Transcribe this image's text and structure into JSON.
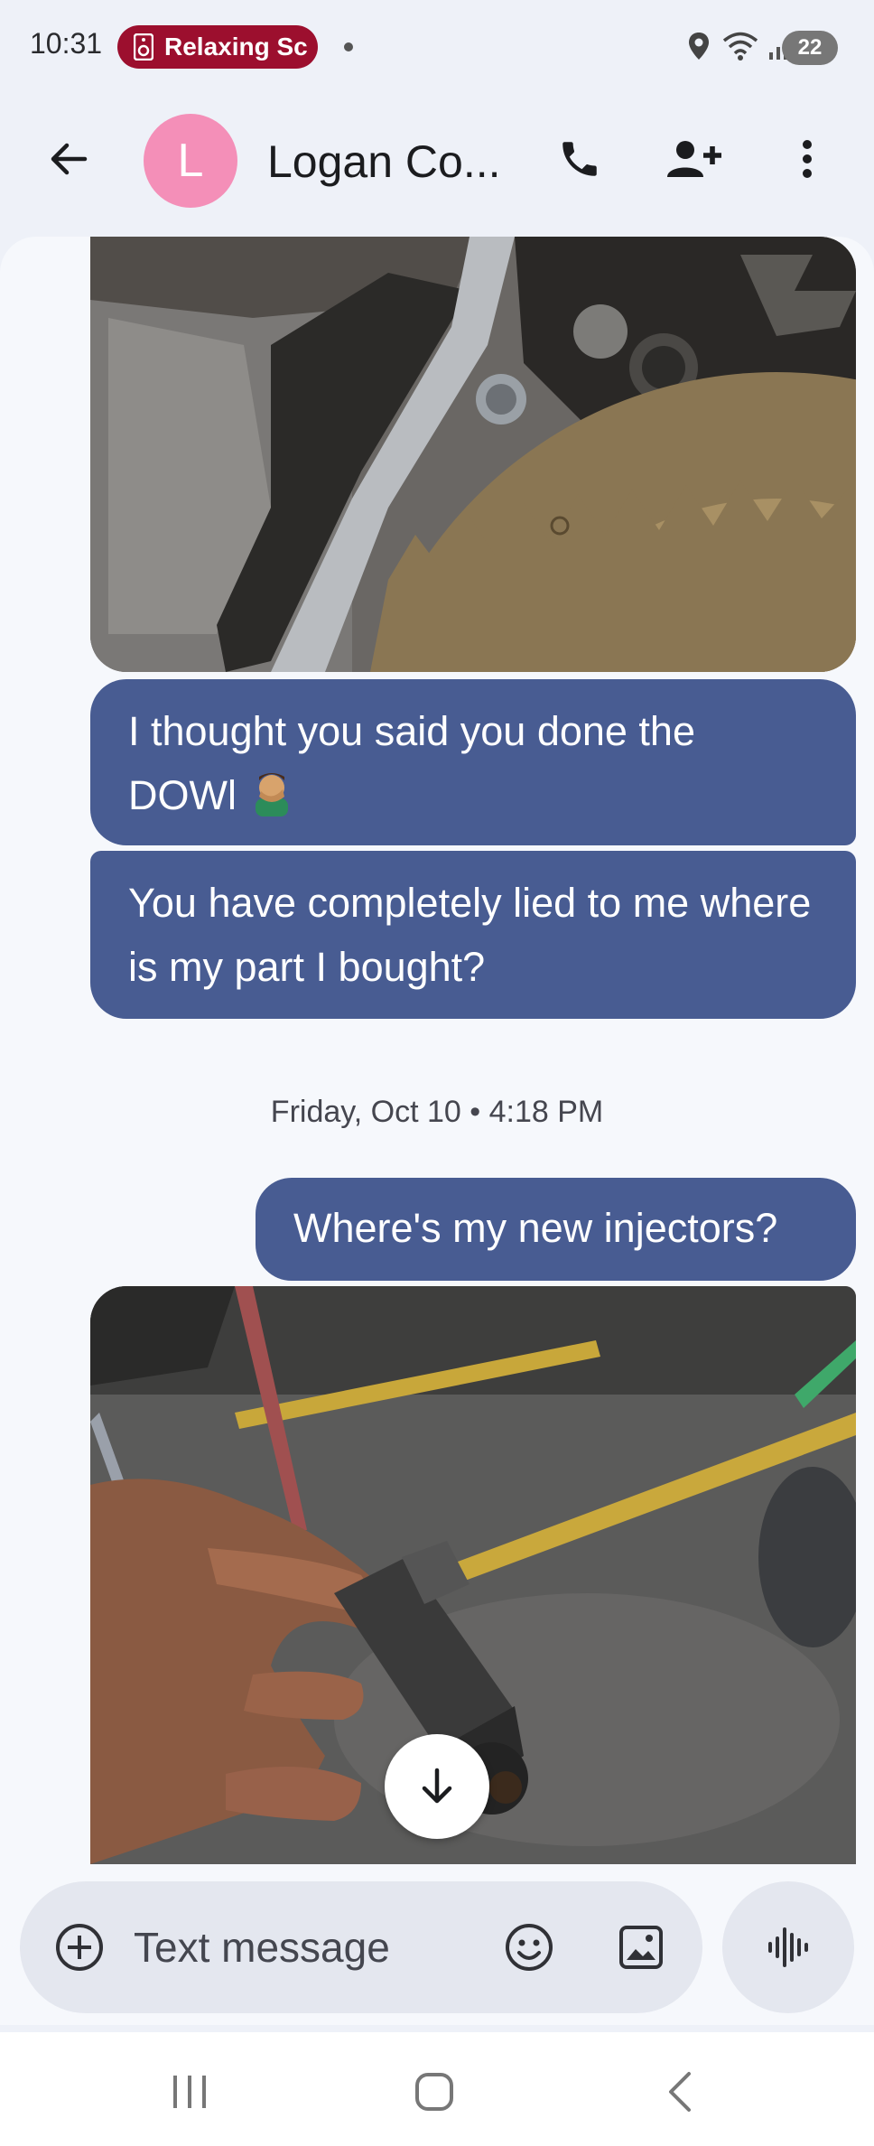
{
  "status_bar": {
    "time": "10:31",
    "media_pill": "Relaxing Sc",
    "battery": "22"
  },
  "header": {
    "avatar_letter": "L",
    "contact_name": "Logan  Co..."
  },
  "messages": [
    {
      "type": "image",
      "direction": "outgoing",
      "description_icon": "photo-engine-gear"
    },
    {
      "type": "text",
      "direction": "outgoing",
      "text": "I thought you said you done the DOWl"
    },
    {
      "type": "text",
      "direction": "outgoing",
      "text": "You have completely lied to me where is my part I bought?"
    },
    {
      "type": "date",
      "text": "Friday, Oct 10 • 4:18 PM"
    },
    {
      "type": "text",
      "direction": "outgoing",
      "text": "Where's my new injectors?"
    },
    {
      "type": "image",
      "direction": "outgoing",
      "description_icon": "photo-injector-in-hand"
    }
  ],
  "compose": {
    "placeholder": "Text message"
  },
  "colors": {
    "bubble": "#485c92",
    "media_pill": "#9c0f2e",
    "avatar": "#f48fb8",
    "background": "#f6f8fc"
  }
}
